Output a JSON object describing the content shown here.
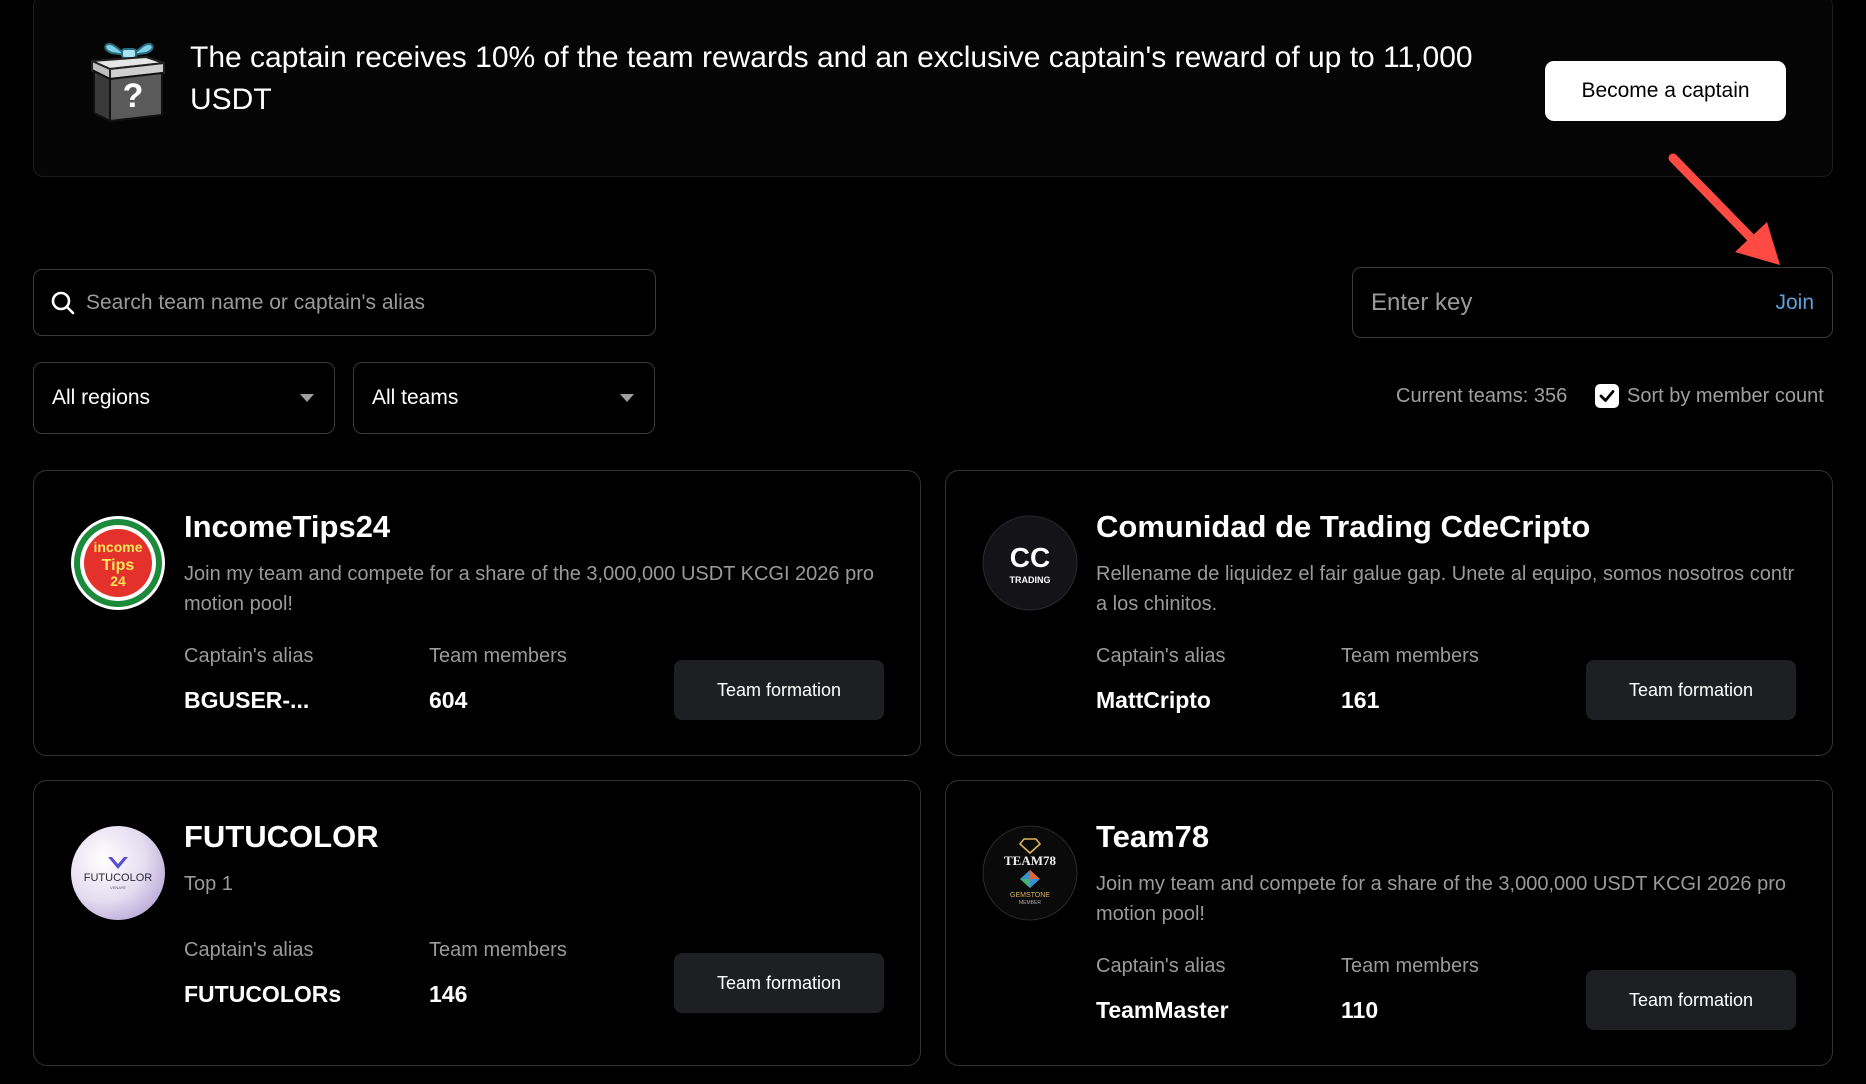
{
  "banner": {
    "text": "The captain receives 10% of the team rewards and an exclusive captain's reward of up to 11,000 USDT",
    "button_label": "Become a captain",
    "gift_icon_mark": "?"
  },
  "search": {
    "placeholder": "Search team name or captain's alias"
  },
  "key": {
    "placeholder": "Enter key",
    "join_label": "Join"
  },
  "filters": {
    "region": "All regions",
    "team_type": "All teams"
  },
  "summary": {
    "current_teams": "Current teams: 356",
    "sort_label": "Sort by member count",
    "sort_checked": true
  },
  "labels": {
    "captain_alias": "Captain's alias",
    "team_members": "Team members",
    "team_formation": "Team formation"
  },
  "teams": [
    {
      "name": "IncomeTips24",
      "description": "Join my team and compete for a share of the 3,000,000 USDT KCGI 2026 promotion pool!",
      "captain": "BGUSER-...",
      "members": "604",
      "logo_lines": [
        "income",
        "Tips",
        "24"
      ]
    },
    {
      "name": "Comunidad de Trading CdeCripto",
      "description": "Rellename de liquidez el fair galue gap. Unete al equipo, somos nosotros contra los chinitos.",
      "captain": "MattCripto",
      "members": "161",
      "logo_lines": [
        "CC",
        "TRADING"
      ]
    },
    {
      "name": "FUTUCOLOR",
      "description": "Top 1",
      "captain": "FUTUCOLORs",
      "members": "146",
      "logo_lines": [
        "FUTUCOLOR",
        "VENAYE"
      ]
    },
    {
      "name": "Team78",
      "description": "Join my team and compete for a share of the 3,000,000 USDT KCGI 2026 promotion pool!",
      "captain": "TeamMaster",
      "members": "110",
      "logo_lines": [
        "TEAM78",
        "GEMSTONE",
        "MEMBER"
      ]
    }
  ],
  "colors": {
    "background": "#000000",
    "accent_link": "#5fa0d8",
    "arrow": "#ff4a43",
    "button_dark": "#1e1f22"
  }
}
